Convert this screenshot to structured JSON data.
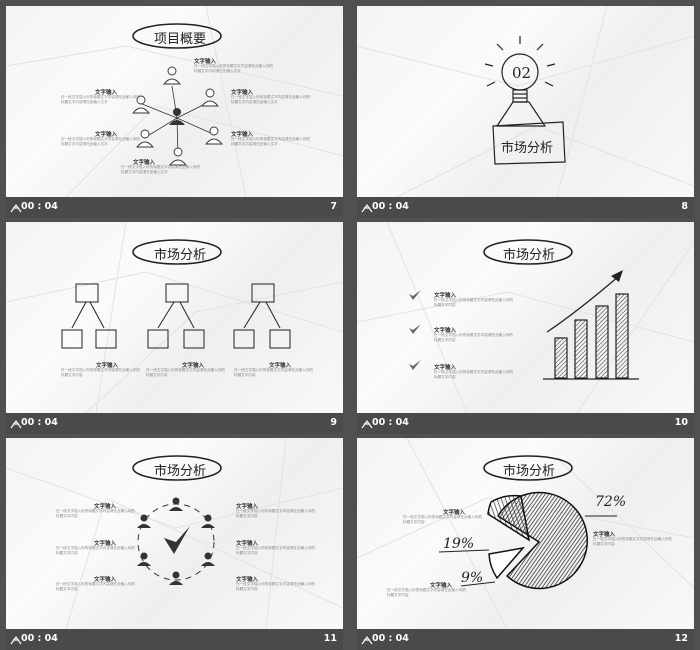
{
  "slides": [
    {
      "time": "00 : 04",
      "number": "7",
      "title": "项目概要",
      "labels": [
        "文字输入",
        "文字输入",
        "文字输入",
        "文字输入",
        "文字输入",
        "文字输入"
      ],
      "body": "在一段文字插入你的标题文字内容请在此输入你的标题文字内容请在此输入文字"
    },
    {
      "time": "00 : 04",
      "number": "8",
      "badge": "02",
      "title": "市场分析"
    },
    {
      "time": "00 : 04",
      "number": "9",
      "title": "市场分析",
      "box_label": "文字\n输入",
      "labels": [
        "文字输入",
        "文字输入",
        "文字输入"
      ],
      "body": "在一段文字插入你的标题文字内容请在此输入你的标题文字内容"
    },
    {
      "time": "00 : 04",
      "number": "10",
      "title": "市场分析",
      "labels": [
        "文字输入",
        "文字输入",
        "文字输入"
      ],
      "body": "在一段文字插入你的标题文字内容请在此输入你的标题文字内容"
    },
    {
      "time": "00 : 04",
      "number": "11",
      "title": "市场分析",
      "labels": [
        "文字输入",
        "文字输入",
        "文字输入",
        "文字输入",
        "文字输入",
        "文字输入"
      ],
      "body": "在一段文字插入你的标题文字内容请在此输入你的标题文字内容"
    },
    {
      "time": "00 : 04",
      "number": "12",
      "title": "市场分析",
      "labels": [
        "文字输入",
        "文字输入",
        "文字输入"
      ],
      "pct": [
        "72%",
        "19%",
        "9%"
      ],
      "body": "在一段文字插入你的标题文字内容请在此输入你的标题文字内容"
    }
  ]
}
